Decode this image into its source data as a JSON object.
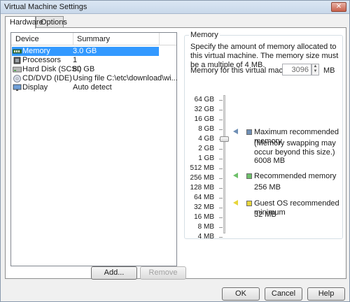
{
  "window": {
    "title": "Virtual Machine Settings",
    "close_glyph": "✕"
  },
  "tabs": [
    {
      "label": "Hardware"
    },
    {
      "label": "Options"
    }
  ],
  "device_list": {
    "columns": {
      "device": "Device",
      "summary": "Summary"
    },
    "rows": [
      {
        "name": "Memory",
        "summary": "3.0 GB",
        "icon": "memory-icon"
      },
      {
        "name": "Processors",
        "summary": "1",
        "icon": "processor-icon"
      },
      {
        "name": "Hard Disk (SCSI)",
        "summary": "80 GB",
        "icon": "hard-disk-icon"
      },
      {
        "name": "CD/DVD (IDE)",
        "summary": "Using file C:\\etc\\download\\wi...",
        "icon": "cd-dvd-icon"
      },
      {
        "name": "Display",
        "summary": "Auto detect",
        "icon": "display-icon"
      }
    ],
    "add_label": "Add...",
    "remove_label": "Remove"
  },
  "memory": {
    "group_title": "Memory",
    "description": "Specify the amount of memory allocated to this virtual machine. The memory size must be a multiple of 4 MB.",
    "field_label": "Memory for this virtual machine:",
    "value": "3096",
    "unit": "MB",
    "scale_labels": [
      "64 GB",
      "32 GB",
      "16 GB",
      "8 GB",
      "4 GB",
      "2 GB",
      "1 GB",
      "512 MB",
      "256 MB",
      "128 MB",
      "64 MB",
      "32 MB",
      "16 MB",
      "8 MB",
      "4 MB"
    ],
    "legend": {
      "max_title": "Maximum recommended memory",
      "max_note": "(Memory swapping may occur beyond this size.)",
      "max_value": "6008 MB",
      "rec_title": "Recommended memory",
      "rec_value": "256 MB",
      "min_title": "Guest OS recommended minimum",
      "min_value": "32 MB"
    },
    "colors": {
      "max": "#6f8fb5",
      "recommended": "#6ec06a",
      "minimum": "#e7d53b"
    }
  },
  "footer": {
    "ok": "OK",
    "cancel": "Cancel",
    "help": "Help"
  }
}
